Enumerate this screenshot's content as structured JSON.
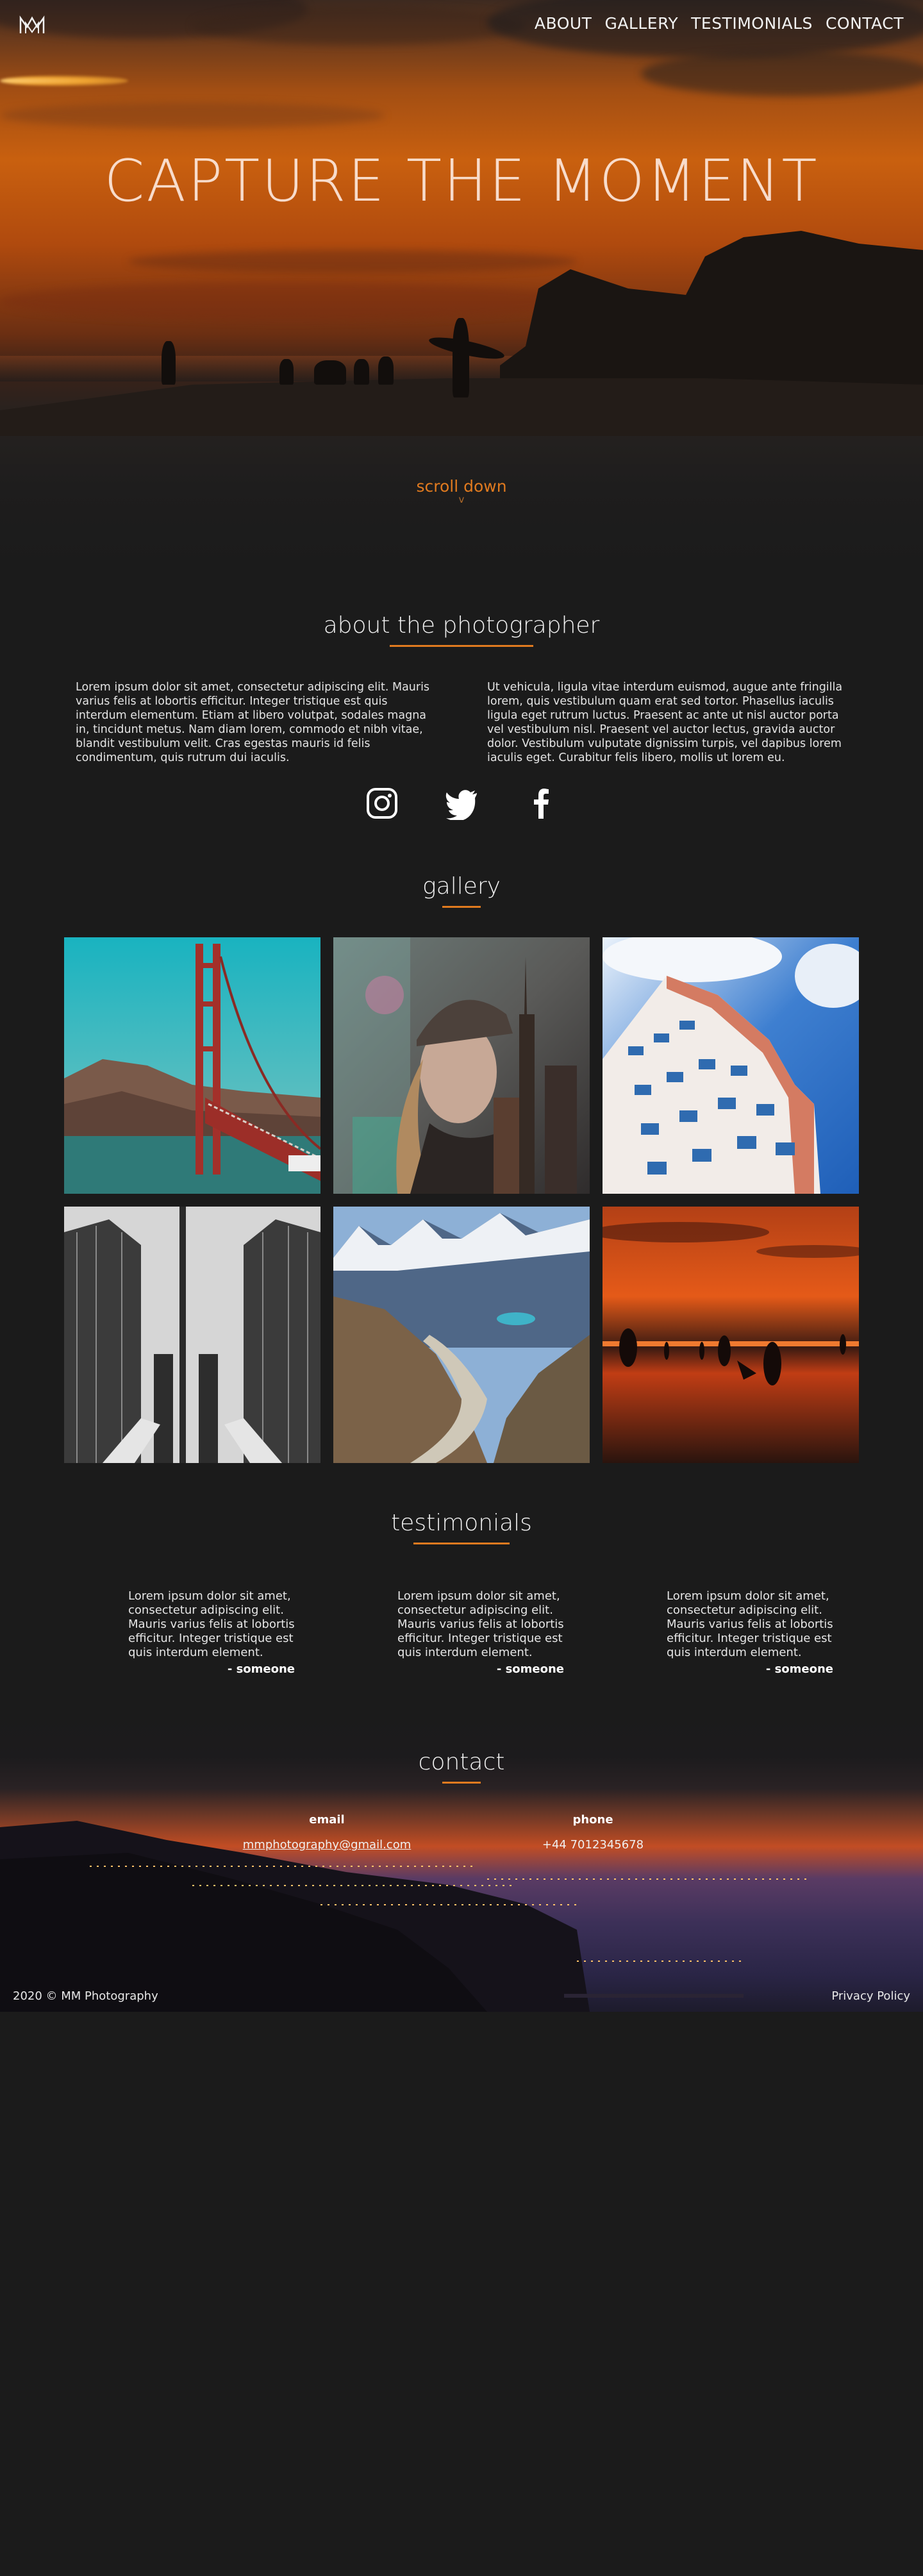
{
  "brand": {
    "logo_text": "MM"
  },
  "nav": {
    "items": [
      "ABOUT",
      "GALLERY",
      "TESTIMONIALS",
      "CONTACT"
    ]
  },
  "hero": {
    "title": "CAPTURE THE MOMENT",
    "scroll_label": "scroll down",
    "scroll_arrow": "v"
  },
  "about": {
    "title": "about the photographer",
    "paragraph_left": "Lorem ipsum dolor sit amet, consectetur adipiscing elit. Mauris varius felis at lobortis efficitur. Integer tristique est quis interdum elementum. Etiam at libero volutpat, sodales magna in, tincidunt metus. Nam diam lorem, commodo et nibh vitae, blandit vestibulum velit. Cras egestas mauris id felis condimentum, quis rutrum dui iaculis.",
    "paragraph_right": "Ut vehicula, ligula vitae interdum euismod, augue ante fringilla lorem, quis vestibulum quam erat sed tortor. Phasellus iaculis ligula eget rutrum luctus. Praesent ac ante ut nisl auctor porta vel vestibulum nisl. Praesent vel auctor lectus, gravida auctor dolor. Vestibulum vulputate dignissim turpis, vel dapibus lorem iaculis eget. Curabitur felis libero, mollis ut lorem eu.",
    "socials": [
      "instagram-icon",
      "twitter-icon",
      "facebook-icon"
    ]
  },
  "gallery": {
    "title": "gallery",
    "photos": [
      "golden-gate-bridge",
      "woman-city-double-exposure",
      "white-building-blue-sky",
      "glass-skyscrapers",
      "mountain-trail",
      "sunset-beach-silhouettes"
    ]
  },
  "testimonials": {
    "title": "testimonials",
    "items": [
      {
        "text": "Lorem ipsum dolor sit amet, consectetur adipiscing elit. Mauris varius felis at lobortis efficitur. Integer tristique est quis interdum element.",
        "author": "- someone"
      },
      {
        "text": "Lorem ipsum dolor sit amet, consectetur adipiscing elit. Mauris varius felis at lobortis efficitur. Integer tristique est quis interdum element.",
        "author": "- someone"
      },
      {
        "text": "Lorem ipsum dolor sit amet, consectetur adipiscing elit. Mauris varius felis at lobortis efficitur. Integer tristique est quis interdum element.",
        "author": "- someone"
      }
    ]
  },
  "contact": {
    "title": "contact",
    "email_label": "email",
    "email_value": "mmphotography@gmail.com",
    "phone_label": "phone",
    "phone_value": "+44 7012345678"
  },
  "footer": {
    "copyright": "2020 © MM Photography",
    "privacy": "Privacy Policy"
  },
  "colors": {
    "accent": "#e07a1f",
    "background": "#1b1b1b",
    "text": "#e8e8e8"
  }
}
